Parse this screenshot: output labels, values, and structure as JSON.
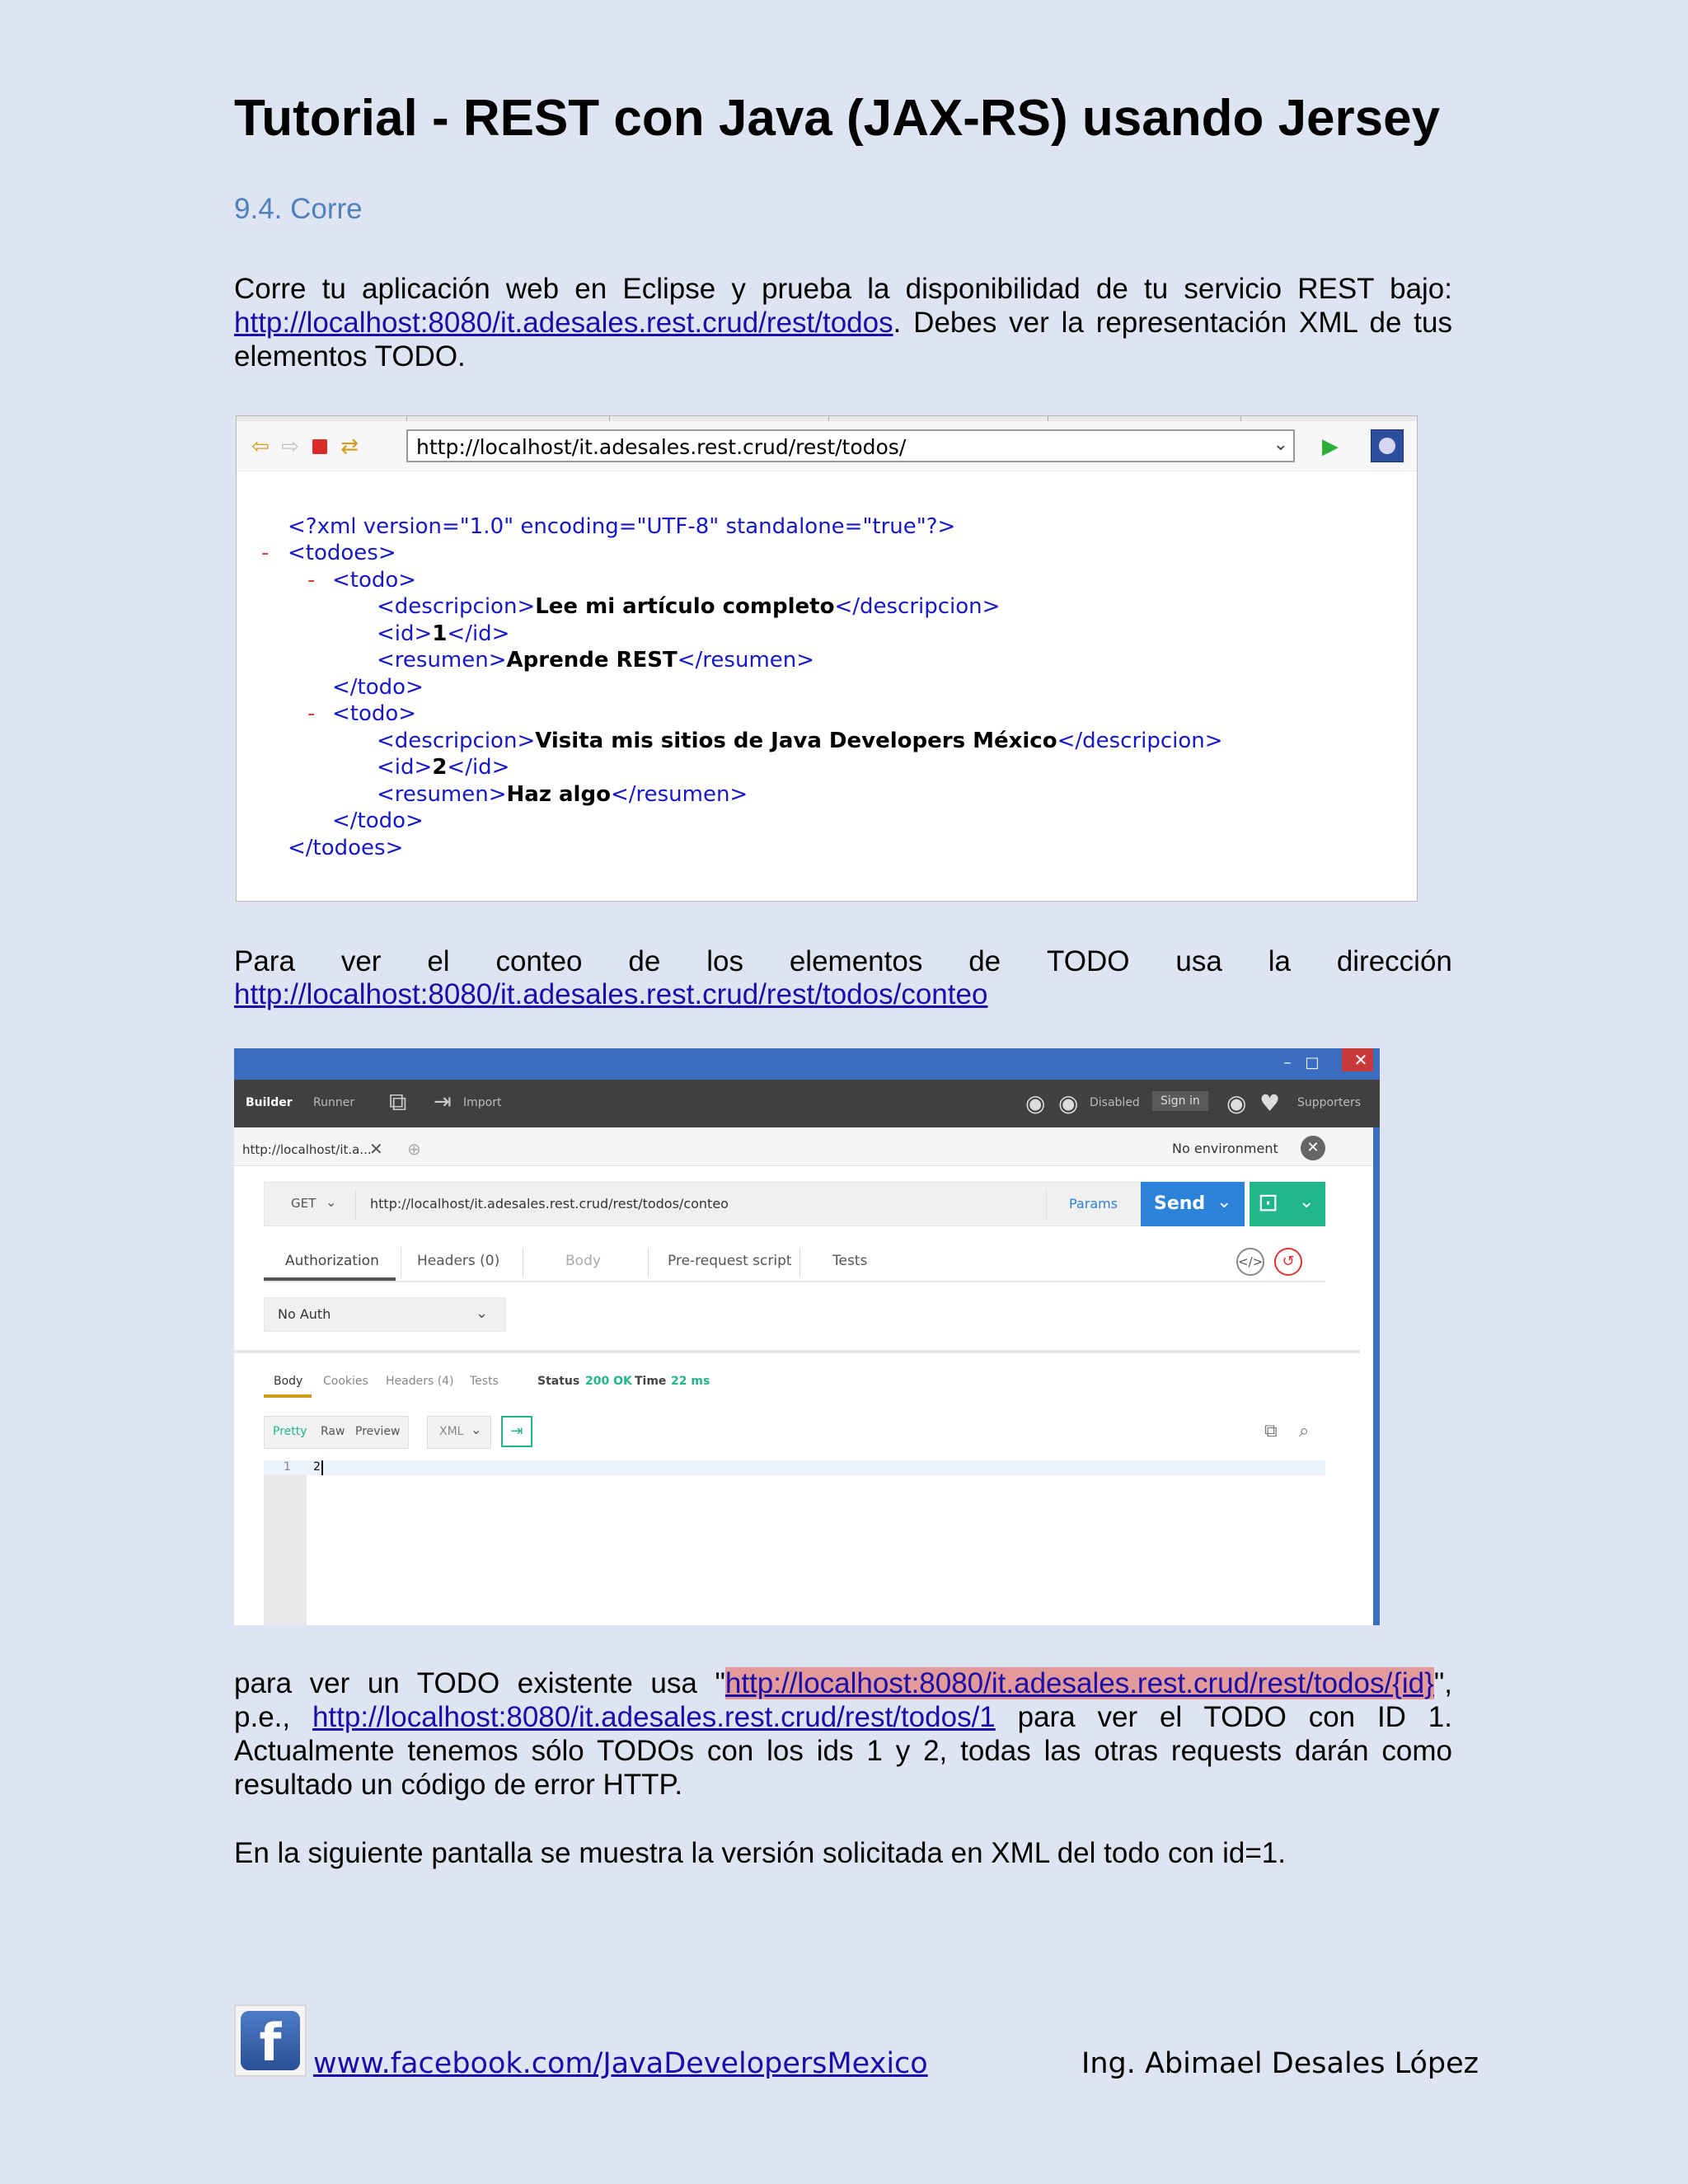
{
  "doc": {
    "title": "Tutorial - REST con Java (JAX-RS) usando Jersey",
    "section": "9.4. Corre",
    "p1_text1": "Corre tu aplicación web en Eclipse y prueba la disponibilidad de tu servicio REST bajo:",
    "p1_link": "http://localhost:8080/it.adesales.rest.crud/rest/todos",
    "p1_text2": ". Debes ver la representación XML de tus elementos TODO.",
    "p2_words": [
      "Para",
      "ver",
      "el",
      "conteo",
      "de",
      "los",
      "elementos",
      "de",
      "TODO",
      "usa",
      "la",
      "dirección"
    ],
    "p2_link": "http://localhost:8080/it.adesales.rest.crud/rest/todos/conteo",
    "p3_text1": "para ver un TODO existente usa \"",
    "p3_link1": "http://localhost:8080/it.adesales.rest.crud/rest/todos/{id}",
    "p3_text2": "\", p.e.,",
    "p3_link2": "http://localhost:8080/it.adesales.rest.crud/rest/todos/1",
    "p3_text3": " para ver el TODO con ID 1. Actualmente tenemos sólo TODOs con los ids 1 y 2, todas las otras requests darán como resultado un código de error HTTP.",
    "p4": "En la siguiente pantalla se muestra la versión solicitada en XML del todo con id=1."
  },
  "browser": {
    "url": "http://localhost/it.adesales.rest.crud/rest/todos/",
    "icons": [
      "back-arrow-icon",
      "forward-arrow-icon",
      "stop-icon",
      "refresh-icon",
      "go-icon",
      "eclipse-icon"
    ],
    "xml_decl": "<?xml version=\"1.0\" encoding=\"UTF-8\" standalone=\"true\"?>",
    "todos": [
      {
        "descripcion": "Lee mi artículo completo",
        "id": "1",
        "resumen": "Aprende REST"
      },
      {
        "descripcion": "Visita mis sitios de Java Developers México",
        "id": "2",
        "resumen": "Haz algo"
      }
    ]
  },
  "postman": {
    "header_tabs": [
      "Builder",
      "Runner"
    ],
    "import": "Import",
    "disabled": "Disabled",
    "sign_in": "Sign in",
    "supporters": "Supporters",
    "tab_url": "http://localhost/it.a...",
    "environment": "No environment",
    "method": "GET",
    "request_url": "http://localhost/it.adesales.rest.crud/rest/todos/conteo",
    "params": "Params",
    "send": "Send",
    "req_tabs": [
      "Authorization",
      "Headers (0)",
      "Body",
      "Pre-request script",
      "Tests"
    ],
    "auth": "No Auth",
    "resp_tabs": [
      "Body",
      "Cookies",
      "Headers (4)",
      "Tests"
    ],
    "status_label": "Status",
    "status_value": "200 OK",
    "time_label": "Time",
    "time_value": "22 ms",
    "view_modes": [
      "Pretty",
      "Raw",
      "Preview"
    ],
    "format": "XML",
    "line_no": "1",
    "body": "2",
    "accent_color": "#2b82d9",
    "save_color": "#20b688"
  },
  "footer": {
    "link": "www.facebook.com/JavaDevelopersMexico",
    "author": "Ing. Abimael Desales López",
    "logo_letter": "f"
  }
}
